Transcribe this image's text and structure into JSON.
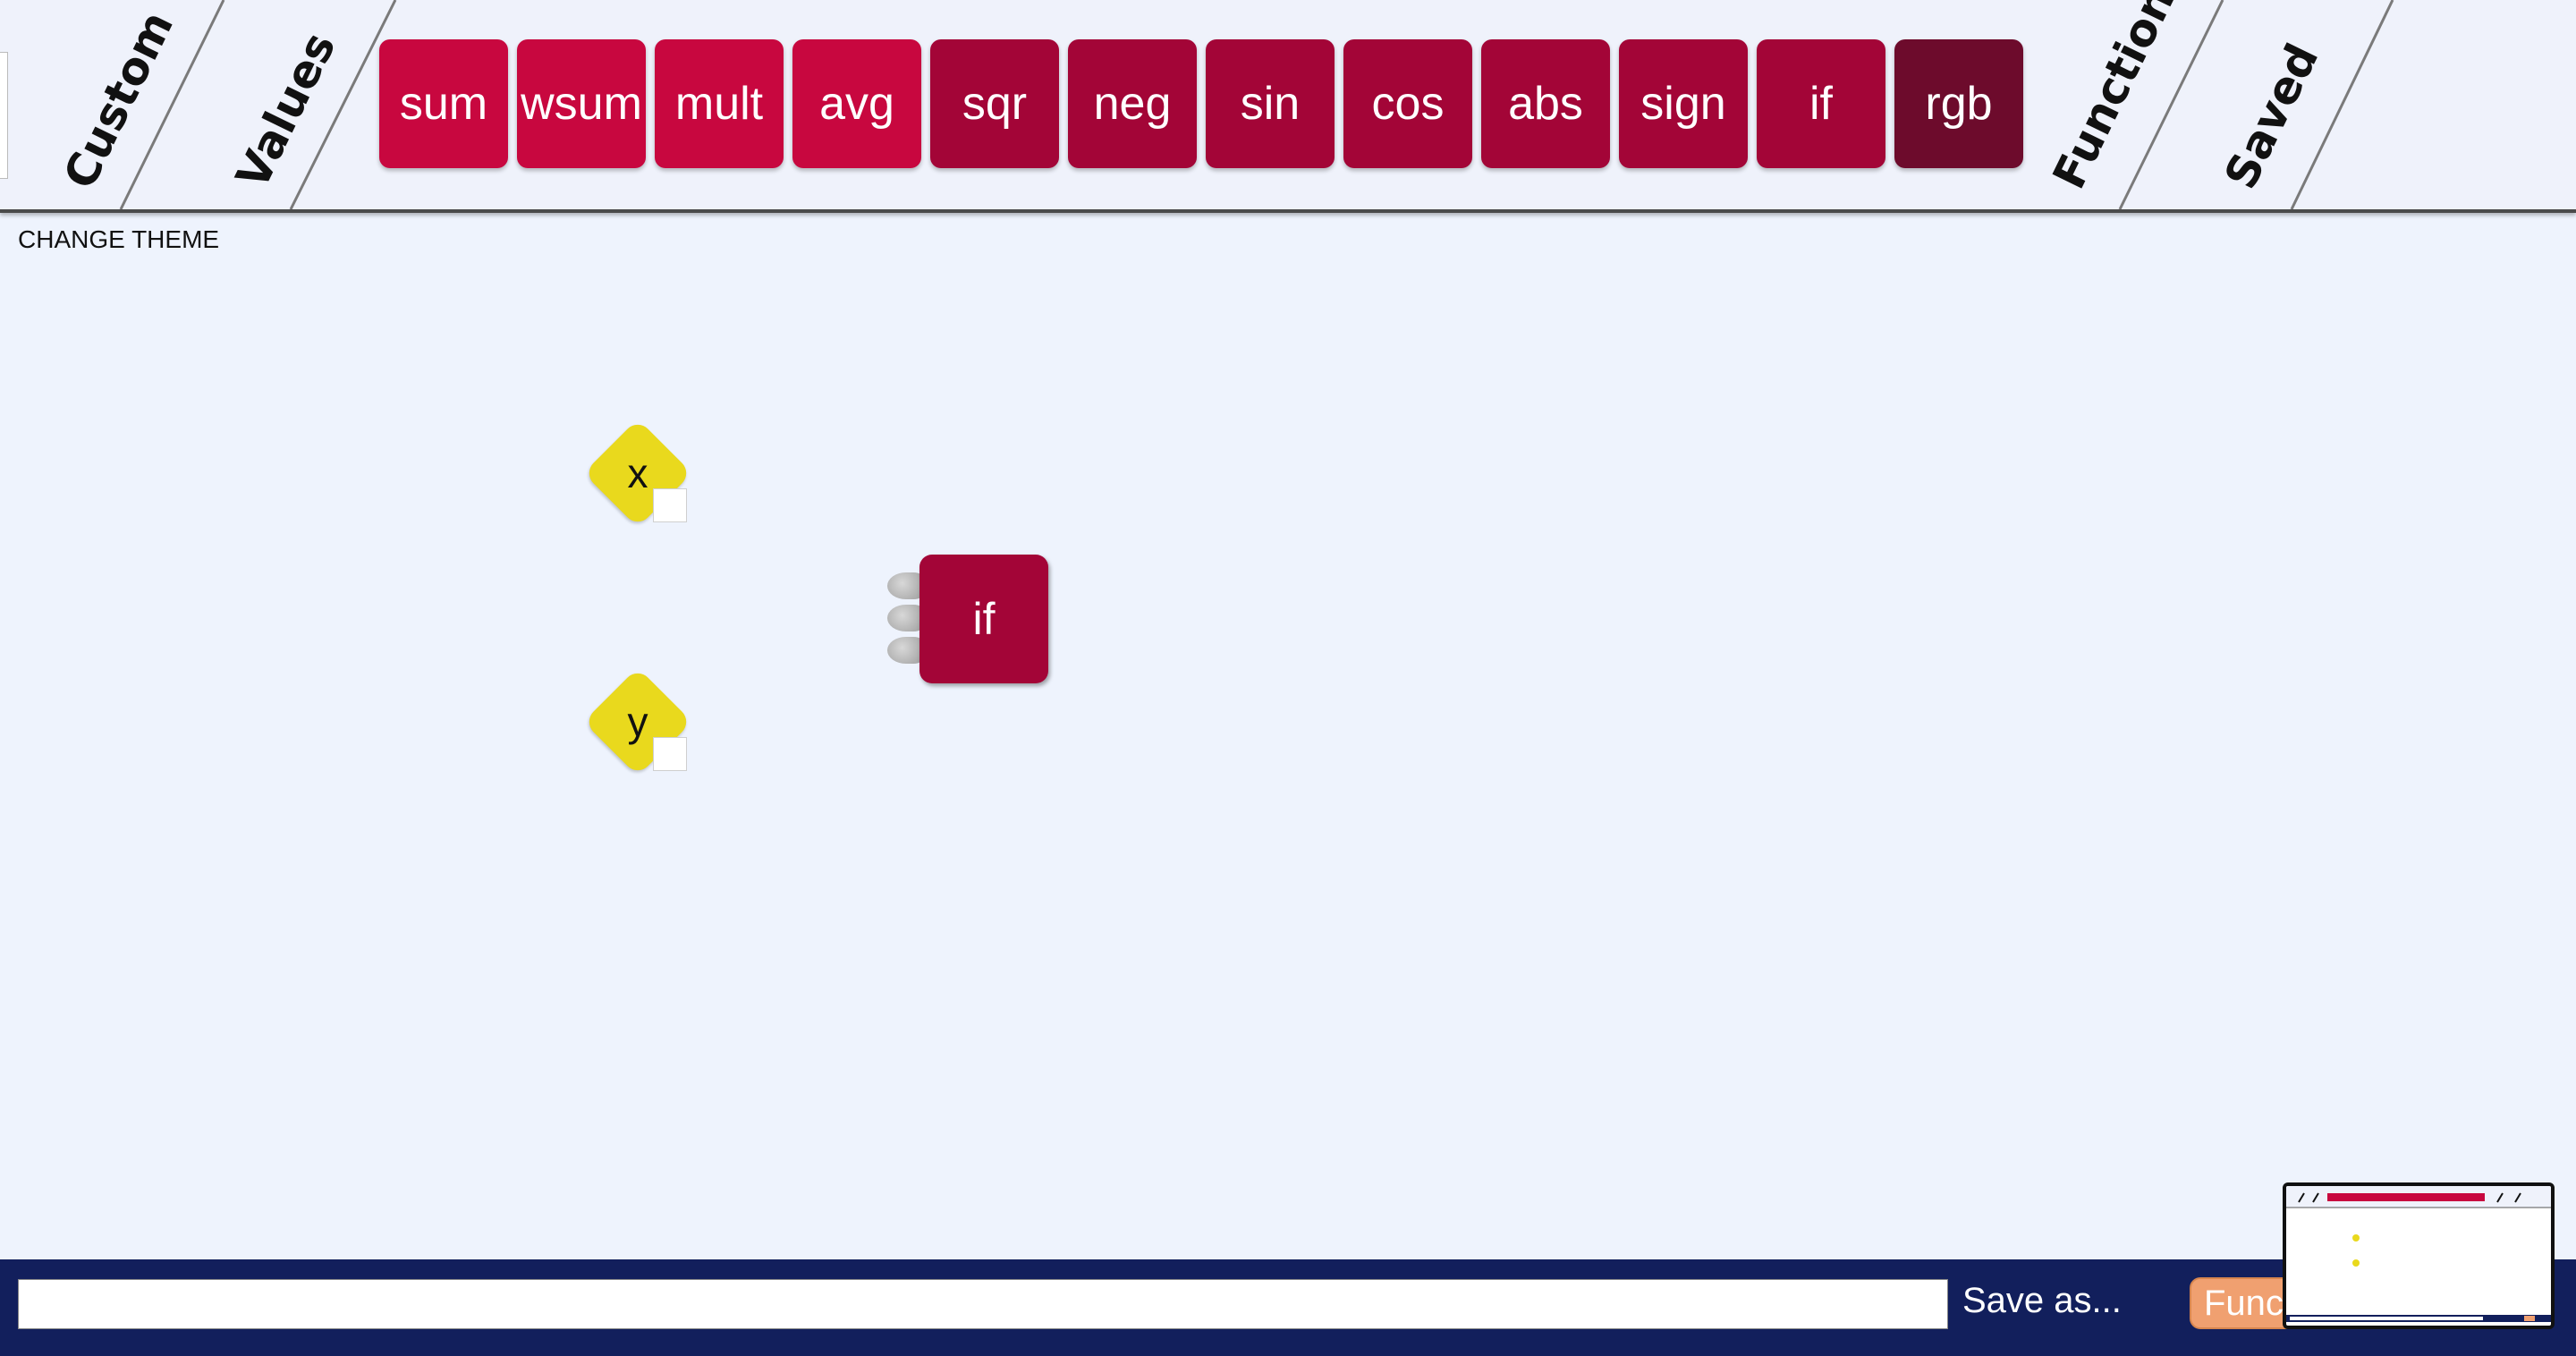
{
  "toolbar": {
    "tabs_left": [
      "Custom",
      "Values"
    ],
    "tabs_right": [
      "Functions",
      "Saved"
    ],
    "functions": [
      {
        "label": "sum",
        "color": "#c8073f"
      },
      {
        "label": "wsum",
        "color": "#c8073f"
      },
      {
        "label": "mult",
        "color": "#c8073f"
      },
      {
        "label": "avg",
        "color": "#c8073f"
      },
      {
        "label": "sqr",
        "color": "#a30537"
      },
      {
        "label": "neg",
        "color": "#a30537"
      },
      {
        "label": "sin",
        "color": "#a30537"
      },
      {
        "label": "cos",
        "color": "#a30537"
      },
      {
        "label": "abs",
        "color": "#a30537"
      },
      {
        "label": "sign",
        "color": "#a30537"
      },
      {
        "label": "if",
        "color": "#a30537"
      },
      {
        "label": "rgb",
        "color": "#6d0b2c"
      }
    ]
  },
  "change_theme": "CHANGE THEME",
  "workspace": {
    "values": [
      {
        "label": "x"
      },
      {
        "label": "y"
      }
    ],
    "operation": {
      "label": "if",
      "inputs": 3
    }
  },
  "bottom_bar": {
    "save_input_value": "",
    "save_as_label": "Save as...",
    "function_button_label": "Funct"
  },
  "colors": {
    "value_node": "#e9d91d",
    "bottom_bar": "#121f5c",
    "background": "#eef3fd"
  }
}
